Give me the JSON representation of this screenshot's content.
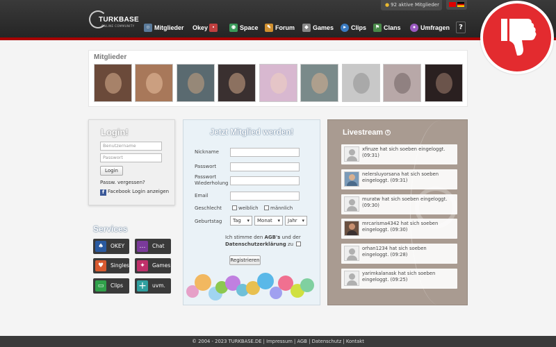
{
  "header": {
    "logo_text": "TURKBASE",
    "logo_subtitle": "ONLINE COMMUNITY",
    "online_count": "92 aktive Mitglieder",
    "nav": [
      {
        "label": "Mitglieder",
        "icon": "members-icon",
        "color": "#5a7a9a"
      },
      {
        "label": "Okey",
        "icon": "okey-tiles-icon",
        "color": "#c04040"
      },
      {
        "label": "Space",
        "icon": "space-icon",
        "color": "#3a9a5a"
      },
      {
        "label": "Forum",
        "icon": "forum-pencil-icon",
        "color": "#d09030"
      },
      {
        "label": "Games",
        "icon": "games-icon",
        "color": "#888888"
      },
      {
        "label": "Clips",
        "icon": "clips-icon",
        "color": "#3a7ac0"
      },
      {
        "label": "Clans",
        "icon": "clans-icon",
        "color": "#4a8a4a"
      },
      {
        "label": "Umfragen",
        "icon": "umfragen-icon",
        "color": "#9a5ac0"
      }
    ],
    "help_label": "?"
  },
  "members": {
    "title": "Mitglieder",
    "thumbs": [
      {
        "bg": "#6b4a3a",
        "face": "#d8b090"
      },
      {
        "bg": "#a8785a",
        "face": "#e8c0a0"
      },
      {
        "bg": "#5a6a70",
        "face": "#c8a080"
      },
      {
        "bg": "#3a3030",
        "face": "#d0a888"
      },
      {
        "bg": "#d8b8d0",
        "face": "#f0d0c0"
      },
      {
        "bg": "#7a8a8a",
        "face": "#d8b090"
      },
      {
        "bg": "#c8c8c8",
        "face": "#909090"
      },
      {
        "bg": "#b8a8a8",
        "face": "#706060"
      },
      {
        "bg": "#2a2020",
        "face": "#a08070"
      }
    ]
  },
  "login": {
    "title": "Login!",
    "username_placeholder": "Benutzername",
    "password_placeholder": "Passwort",
    "button": "Login",
    "forgot": "Passw. vergessen?",
    "facebook": "Facebook Login anzeigen"
  },
  "services": {
    "title": "Services",
    "items": [
      {
        "label": "OKEY",
        "icon": "okey-cards-icon",
        "color": "#2a5aa0",
        "glyph": "♠"
      },
      {
        "label": "Chat",
        "icon": "chat-bubble-icon",
        "color": "#7a3a9a",
        "glyph": "…"
      },
      {
        "label": "Singles",
        "icon": "heart-icon",
        "color": "#d85a30",
        "glyph": "♥"
      },
      {
        "label": "Games",
        "icon": "gamepad-icon",
        "color": "#c0306a",
        "glyph": "✦"
      },
      {
        "label": "Clips",
        "icon": "film-icon",
        "color": "#30a04a",
        "glyph": "▭"
      },
      {
        "label": "uvm.",
        "icon": "plus-icon",
        "color": "#30a0a0",
        "glyph": "+"
      }
    ]
  },
  "register": {
    "title": "Jetzt Mitglied werden!",
    "nickname": "Nickname",
    "password": "Passwort",
    "password_repeat_1": "Passwort",
    "password_repeat_2": "Wiederholung",
    "email": "Email",
    "gender": "Geschlecht",
    "female": "weiblich",
    "male": "männlich",
    "birthday": "Geburtstag",
    "day": "Tag",
    "month": "Monat",
    "year": "Jahr",
    "agb_prefix": "Ich stimme den",
    "agb_link": "AGB's",
    "agb_and": "und der",
    "privacy_link": "Datenschutzerklärung",
    "agb_suffix": "zu",
    "submit": "Registrieren"
  },
  "livestream": {
    "title": "Livestream",
    "count": "0",
    "entries": [
      {
        "text": "xfiruze hat sich soeben eingeloggt. (09:31)",
        "avatar_bg": "#eeeeee"
      },
      {
        "text": "nelersluyorsana hat sich soeben eingeloggt. (09:31)",
        "avatar_bg": "#7a9ab8"
      },
      {
        "text": "muratw hat sich soeben eingeloggt. (09:30)",
        "avatar_bg": "#eeeeee"
      },
      {
        "text": "mrcarisma4342 hat sich soeben eingeloggt. (09:30)",
        "avatar_bg": "#6a5040"
      },
      {
        "text": "orhan1234 hat sich soeben eingeloggt. (09:28)",
        "avatar_bg": "#eeeeee"
      },
      {
        "text": "yarimkalanask hat sich soeben eingeloggt. (09:25)",
        "avatar_bg": "#eeeeee"
      }
    ]
  },
  "footer": {
    "text": "© 2004 - 2023 TURKBASE.DE | Impressum | AGB | Datenschutz | Kontakt"
  }
}
